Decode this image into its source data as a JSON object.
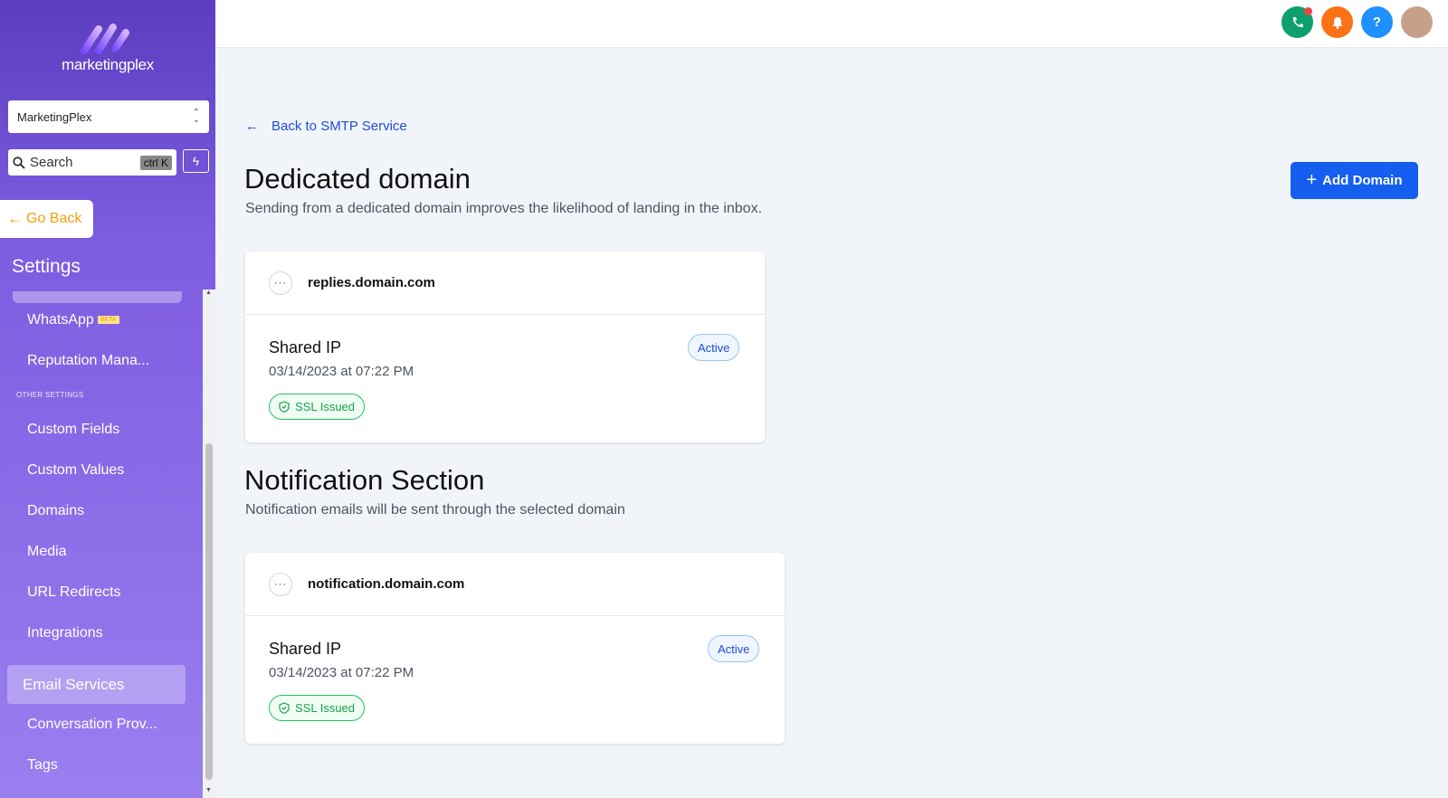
{
  "brand": {
    "name": "marketingplex"
  },
  "sidebar": {
    "account": "MarketingPlex",
    "search_label": "Search",
    "search_shortcut": "ctrl K",
    "go_back": "Go Back",
    "title": "Settings",
    "items": [
      {
        "label": "WhatsApp",
        "badge": "BETA"
      },
      {
        "label": "Reputation Mana..."
      },
      {
        "label": "Custom Fields"
      },
      {
        "label": "Custom Values"
      },
      {
        "label": "Domains"
      },
      {
        "label": "Media"
      },
      {
        "label": "URL Redirects"
      },
      {
        "label": "Integrations"
      },
      {
        "label": "Email Services",
        "active": true
      },
      {
        "label": "Conversation Prov..."
      },
      {
        "label": "Tags"
      }
    ],
    "section_other": "OTHER SETTINGS"
  },
  "header": {
    "icons": [
      {
        "name": "phone-icon",
        "color": "#0e9f6e"
      },
      {
        "name": "bell-icon",
        "color": "#f97316"
      },
      {
        "name": "help-icon",
        "color": "#1e90ff"
      },
      {
        "name": "avatar",
        "color": "#c8a08a"
      }
    ],
    "help_glyph": "?"
  },
  "main": {
    "back_link": "Back to SMTP Service",
    "dedicated": {
      "title": "Dedicated domain",
      "subtitle": "Sending from a dedicated domain improves the likelihood of landing in the inbox."
    },
    "add_domain": "Add Domain",
    "notification": {
      "title": "Notification Section",
      "subtitle": "Notification emails will be sent through the selected domain"
    },
    "cards": [
      {
        "domain": "replies.domain.com",
        "ip": "Shared IP",
        "date": "03/14/2023 at 07:22 PM",
        "status": "Active",
        "ssl": "SSL Issued"
      },
      {
        "domain": "notification.domain.com",
        "ip": "Shared IP",
        "date": "03/14/2023 at 07:22 PM",
        "status": "Active",
        "ssl": "SSL Issued"
      }
    ]
  },
  "colors": {
    "accent": "#155eef",
    "sidebar_top": "#5b3dbf",
    "sidebar_bottom": "#9a7ff0",
    "go_back": "#f59e0b",
    "ssl_green": "#16a34a"
  }
}
